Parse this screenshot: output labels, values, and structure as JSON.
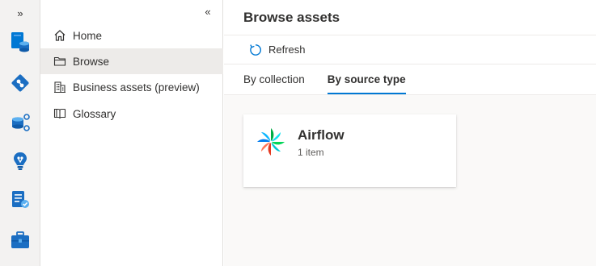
{
  "rail": {
    "expand_glyph": "»",
    "icons": [
      "data-map-icon",
      "data-catalog-icon",
      "data-estate-icon",
      "insights-icon",
      "policy-icon",
      "management-icon"
    ]
  },
  "nav": {
    "collapse_glyph": "«",
    "items": [
      {
        "label": "Home",
        "icon": "home-icon",
        "selected": false
      },
      {
        "label": "Browse",
        "icon": "folder-icon",
        "selected": true
      },
      {
        "label": "Business assets (preview)",
        "icon": "building-icon",
        "selected": false
      },
      {
        "label": "Glossary",
        "icon": "book-icon",
        "selected": false
      }
    ]
  },
  "main": {
    "title": "Browse assets",
    "refresh_label": "Refresh",
    "tabs": [
      {
        "label": "By collection",
        "active": false
      },
      {
        "label": "By source type",
        "active": true
      }
    ],
    "card": {
      "title": "Airflow",
      "subtitle": "1 item",
      "icon": "airflow-logo"
    }
  },
  "colors": {
    "accent": "#0078d4",
    "rail_bg": "#f3f2f1",
    "selected_bg": "#edebe9"
  }
}
